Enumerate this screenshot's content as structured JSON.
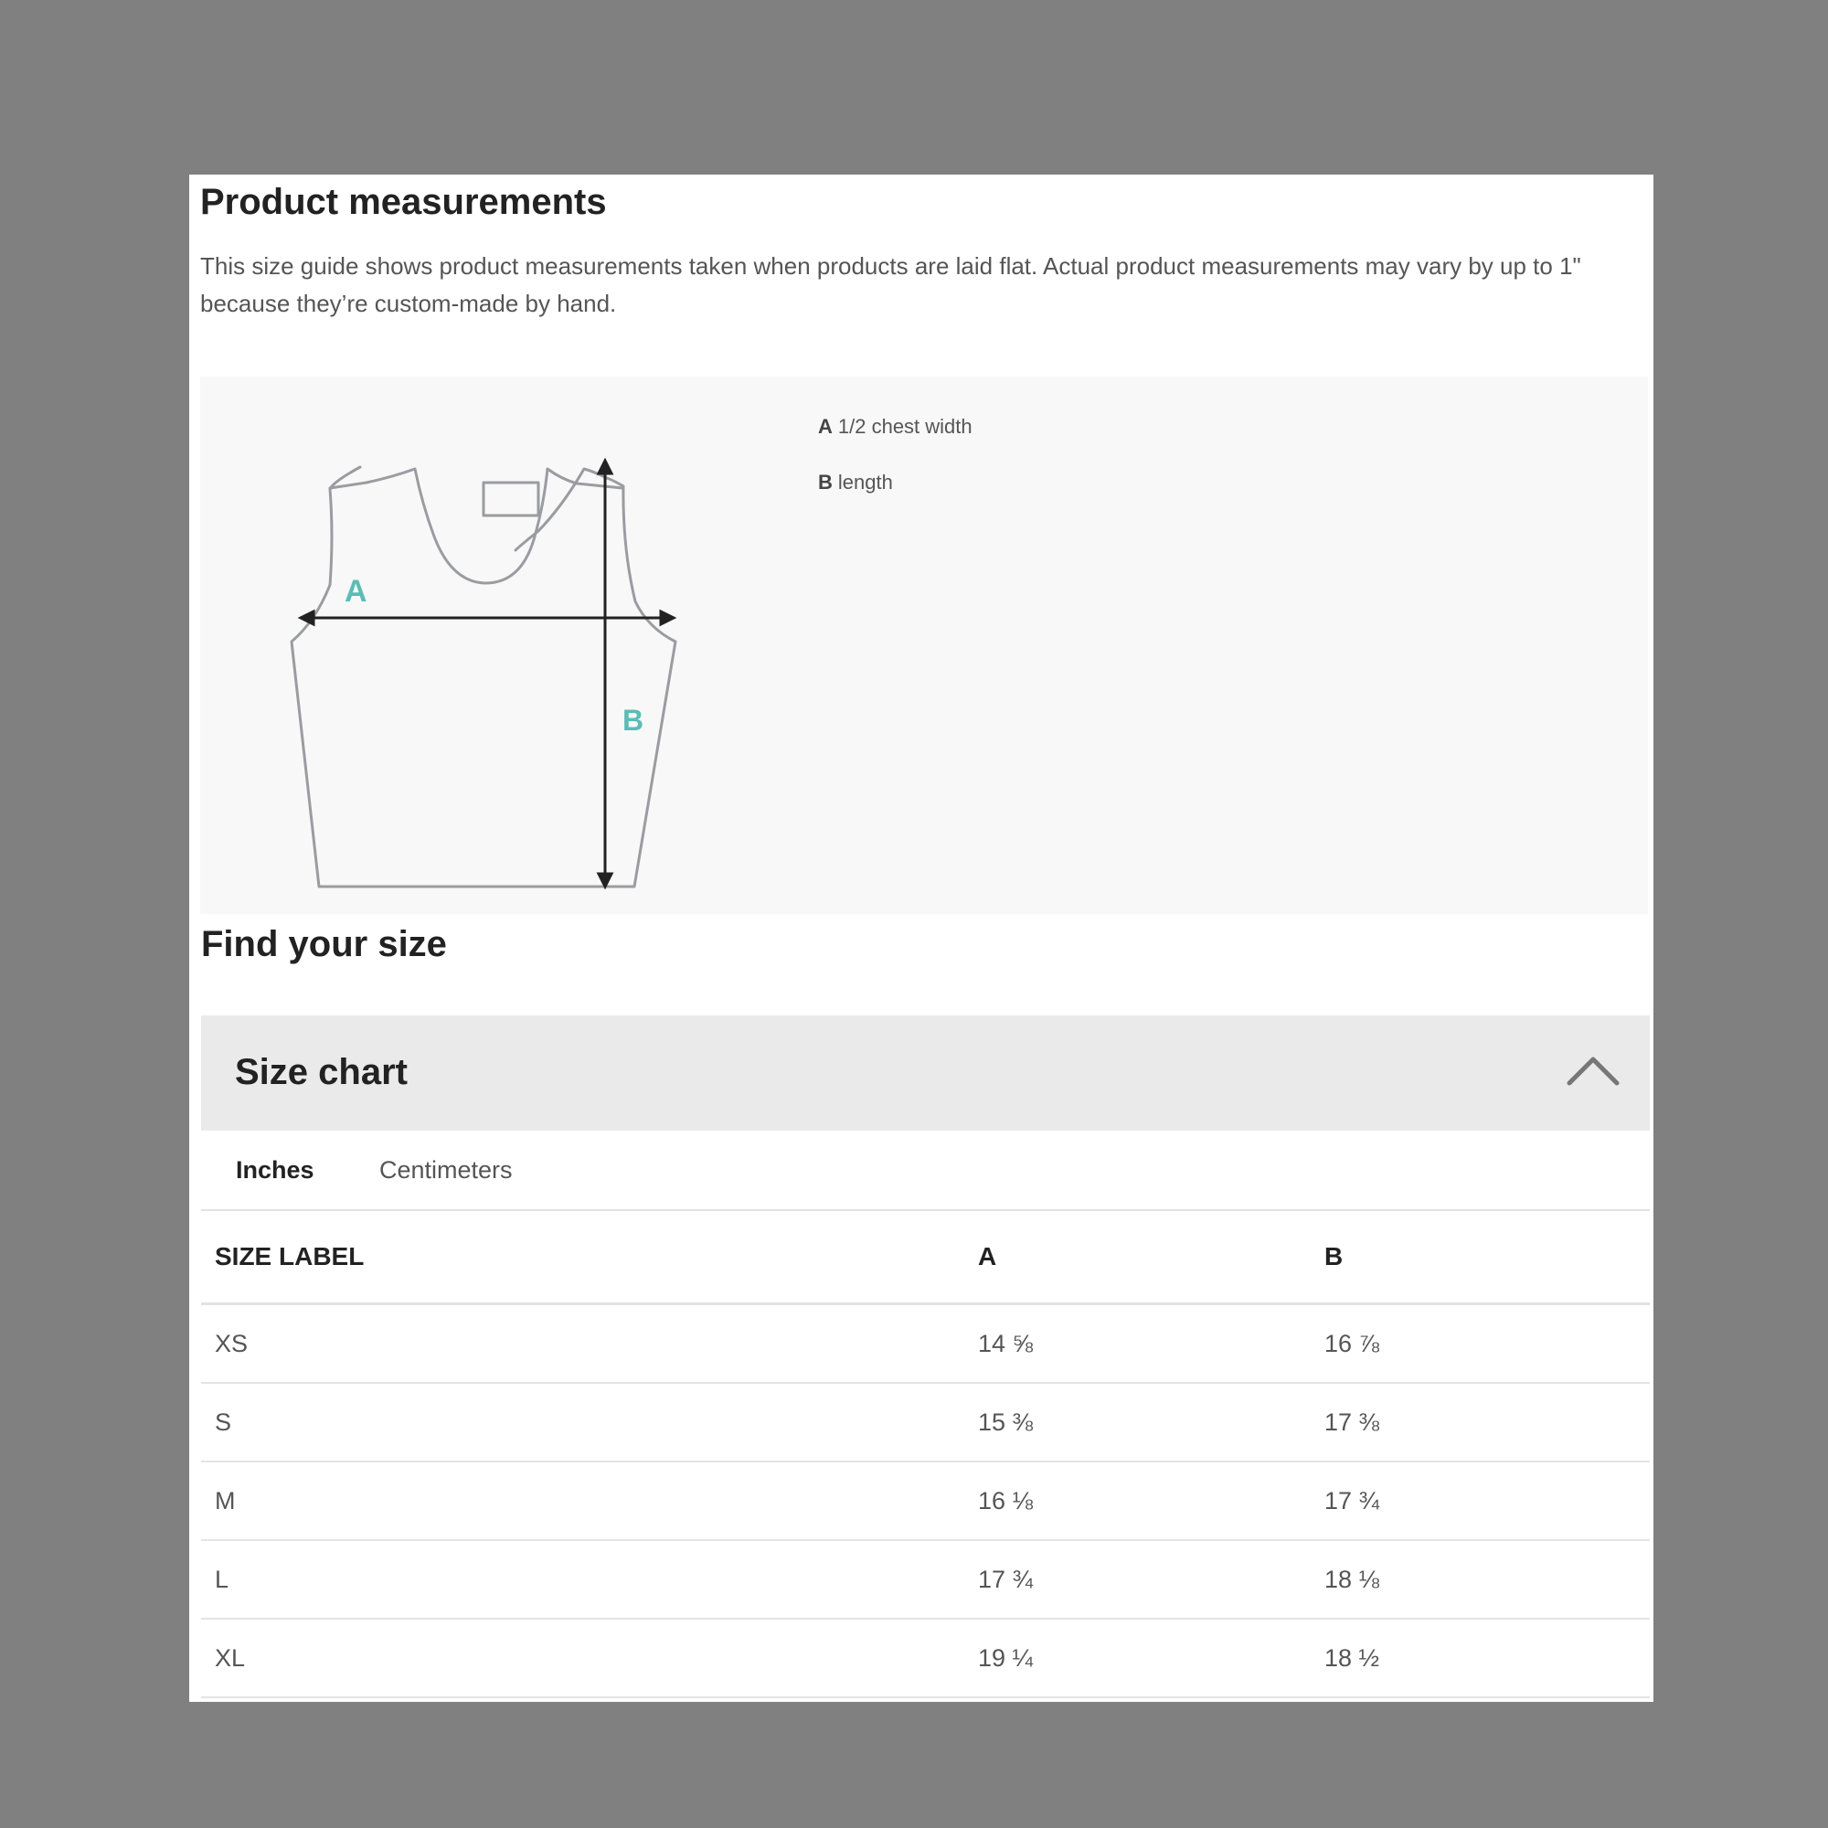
{
  "header": {
    "title": "Product measurements",
    "intro": "This size guide shows product measurements taken when products are laid flat. Actual product measurements may vary by up to 1\" because they’re custom-made by hand."
  },
  "diagram": {
    "label_a": "A",
    "label_b": "B",
    "legend": [
      {
        "key": "A",
        "text": "1/2 chest width"
      },
      {
        "key": "B",
        "text": "length"
      }
    ],
    "accent_color": "#5bbdb5"
  },
  "find_size": {
    "title": "Find your size"
  },
  "size_chart": {
    "title": "Size chart",
    "toggle_icon": "chevron-up-icon",
    "tabs": [
      {
        "label": "Inches",
        "active": true
      },
      {
        "label": "Centimeters",
        "active": false
      }
    ],
    "columns": [
      "SIZE LABEL",
      "A",
      "B"
    ],
    "rows": [
      [
        "XS",
        "14 ⅝",
        "16 ⅞"
      ],
      [
        "S",
        "15 ⅜",
        "17 ⅜"
      ],
      [
        "M",
        "16 ⅛",
        "17 ¾"
      ],
      [
        "L",
        "17 ¾",
        "18 ⅛"
      ],
      [
        "XL",
        "19 ¼",
        "18 ½"
      ]
    ]
  }
}
